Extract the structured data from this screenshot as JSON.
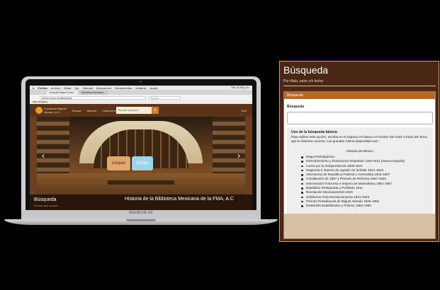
{
  "laptop": {
    "model_label": "MacBook Air",
    "browser": {
      "menu_items": [
        "Firefox",
        "Archivo",
        "Editar",
        "Ver",
        "Historial",
        "Marcadores",
        "Herramientas",
        "Ventana",
        "Ayuda"
      ],
      "status_text": "Vie 10:38 p.m.",
      "tabs": [
        "Consulta Miguel Lerdo...",
        "Biblioteca Mexicana ..."
      ],
      "url": "bdl.cm.unam.mx/biblioteca/...",
      "search_placeholder": "Buscar",
      "bookmarks_label": "Más visitados"
    },
    "site": {
      "logo_text": "Fundación Miguel Alemán, A.C.",
      "nav_items": [
        "Buscar",
        "Historia",
        "Colecciones"
      ],
      "search_placeholder": "Buscar ejemplar",
      "nav_right": "Salir"
    },
    "bottom_left_title": "Búsqueda",
    "bottom_left_sub": "Por titulo, autor o/a fecha",
    "bottom_headline": "Historia de la Biblioteca Mexicana de la FMA, A.C"
  },
  "panel": {
    "title": "Búsqueda",
    "subtitle": "Por título, autor y/o fecha",
    "card_header": "Búsqueda",
    "field_label": "Búsqueda",
    "help_title": "Uso de la búsqueda básica:",
    "help_body": "Para utilizar esta opción, escriba en el espacio en blanco el nombre del Autor o título del Tema que le interesa conocer. Los grandes rubros disponibles son:",
    "help_center": "Historia de México",
    "topics": [
      "Etapa Prehispánica",
      "Descubrimiento y Dominación Española 1492-1821 (Nueva España)",
      "Lucha por la Independencia 1808-1821",
      "Regencia e Imperio de Agustín de Iturbide 1821-1823",
      "Alternancia de República Federal o Centralista 1823-1857",
      "Constitución de 1857 y Período de Reforma 1857-1863",
      "Intervención Francesa e Imperio de Maximiliano 1861-1867",
      "República Restaurada y Porfiriato 1911",
      "Revolución Mexicana1910-1920",
      "Gobiernos Post-Revolucionarios 1921-1946",
      "Periodo Presidencial de Miguel Alemán 1946-1952",
      "Desarrollo Estabilizador y Priismo 1952-1988"
    ],
    "btn_clear": "Limpiar",
    "btn_send": "Enviar"
  }
}
